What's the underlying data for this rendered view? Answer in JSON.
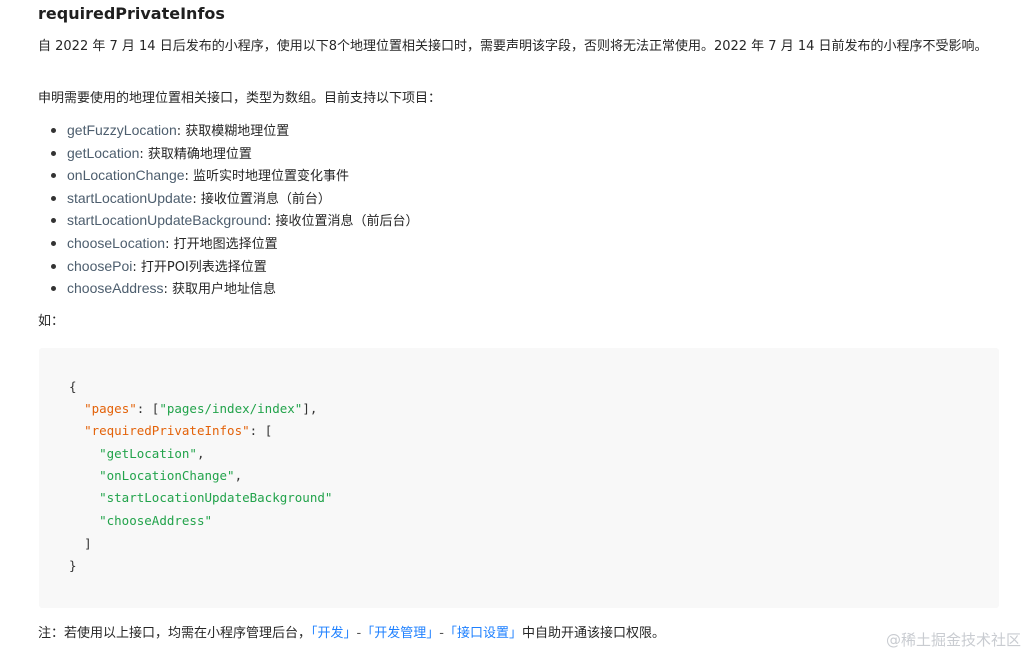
{
  "title": "requiredPrivateInfos",
  "intro": "自 2022 年 7 月 14 日后发布的小程序，使用以下8个地理位置相关接口时，需要声明该字段，否则将无法正常使用。2022 年 7 月 14 日前发布的小程序不受影响。",
  "desc": "申明需要使用的地理位置相关接口，类型为数组。目前支持以下项目：",
  "apis": [
    {
      "name": "getFuzzyLocation",
      "desc": ": 获取模糊地理位置"
    },
    {
      "name": "getLocation",
      "desc": ": 获取精确地理位置"
    },
    {
      "name": "onLocationChange",
      "desc": ": 监听实时地理位置变化事件"
    },
    {
      "name": "startLocationUpdate",
      "desc": ": 接收位置消息（前台）"
    },
    {
      "name": "startLocationUpdateBackground",
      "desc": ": 接收位置消息（前后台）"
    },
    {
      "name": "chooseLocation",
      "desc": ": 打开地图选择位置"
    },
    {
      "name": "choosePoi",
      "desc": ": 打开POI列表选择位置"
    },
    {
      "name": "chooseAddress",
      "desc": ": 获取用户地址信息"
    }
  ],
  "example_label": "如：",
  "code": {
    "open_brace": "{",
    "pages_key": "\"pages\"",
    "pages_colon_open": ": [",
    "pages_value": "\"pages/index/index\"",
    "pages_close": "],",
    "rpi_key": "\"requiredPrivateInfos\"",
    "rpi_colon_open": ": [",
    "items": [
      "\"getLocation\"",
      "\"onLocationChange\"",
      "\"startLocationUpdateBackground\"",
      "\"chooseAddress\""
    ],
    "item_commas": [
      ",",
      ",",
      "",
      ""
    ],
    "close_bracket": "]",
    "close_brace": "}"
  },
  "note": {
    "prefix": "注：若使用以上接口，均需在小程序管理后台，",
    "link1": "「开发」",
    "sep1": "-",
    "link2": "「开发管理」",
    "sep2": "-",
    "link3": "「接口设置」",
    "suffix": "中自助开通该接口权限。"
  },
  "watermark": "@稀土掘金技术社区"
}
